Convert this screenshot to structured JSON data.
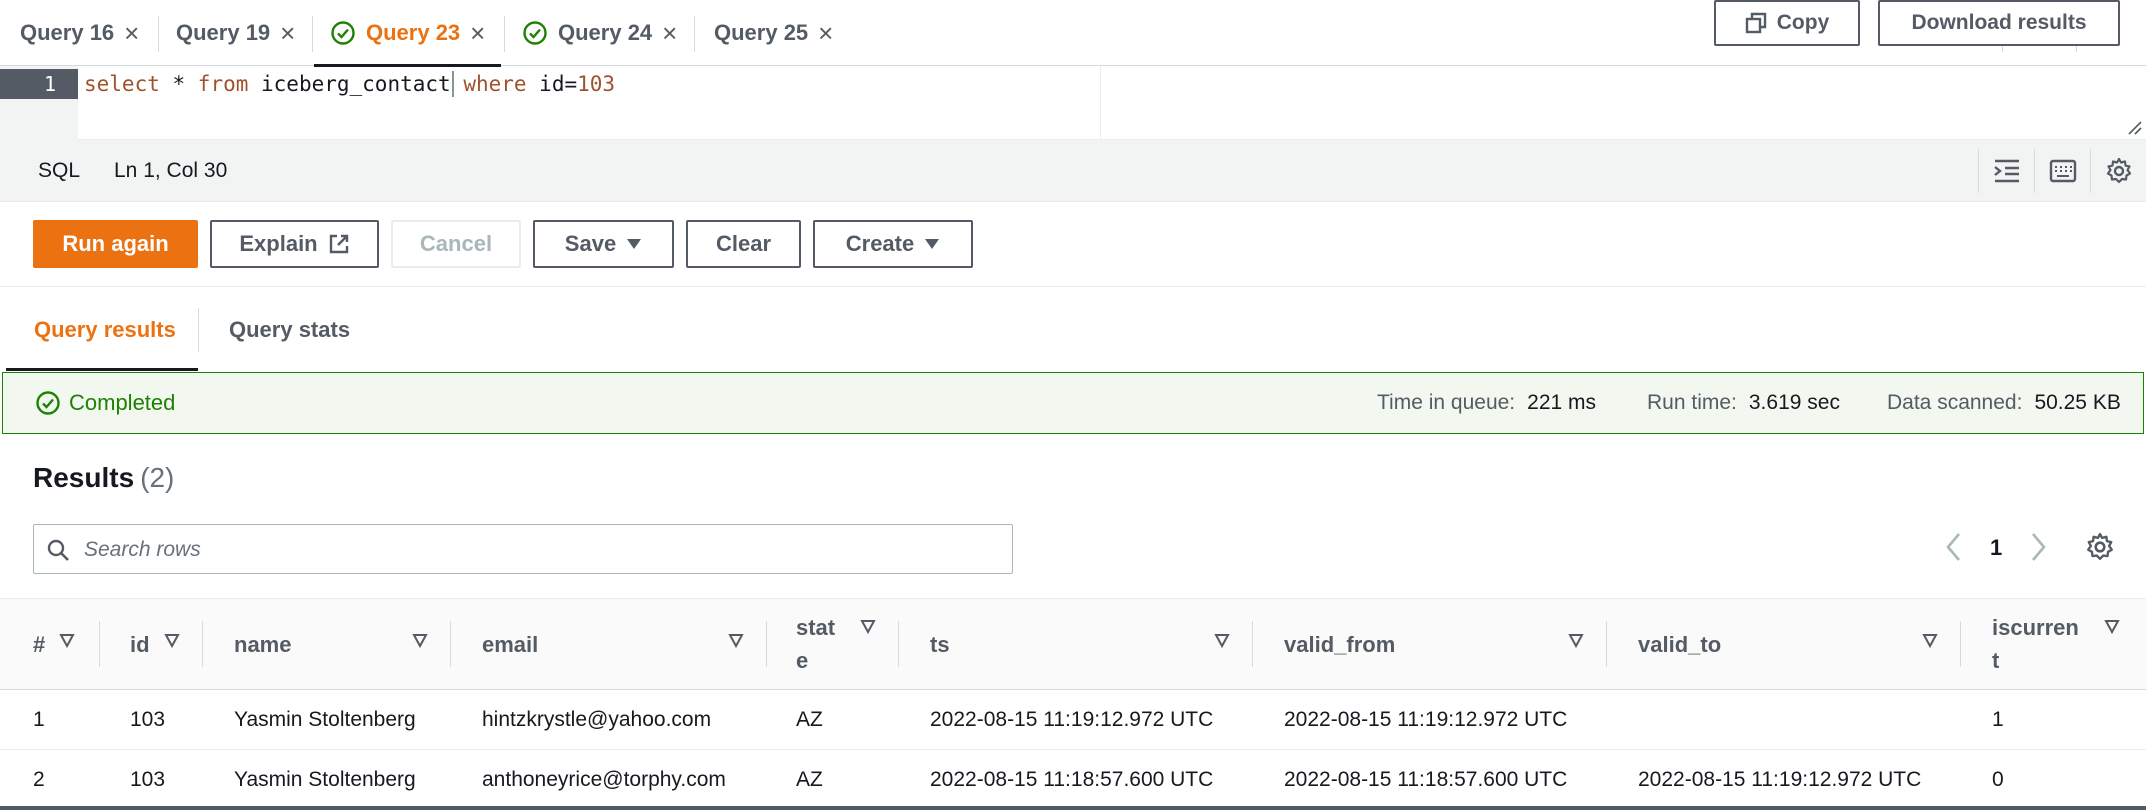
{
  "tabs": [
    {
      "label": "Query 16",
      "status": "none",
      "active": false
    },
    {
      "label": "Query 19",
      "status": "none",
      "active": false
    },
    {
      "label": "Query 23",
      "status": "success",
      "active": true
    },
    {
      "label": "Query 24",
      "status": "success",
      "active": false
    },
    {
      "label": "Query 25",
      "status": "none",
      "active": false
    }
  ],
  "editor": {
    "line_number": "1",
    "tokens": [
      "select",
      " * ",
      "from",
      " iceberg_contact ",
      "where",
      " id=",
      "103"
    ]
  },
  "status_bar": {
    "language": "SQL",
    "cursor_position": "Ln 1, Col 30"
  },
  "actions": {
    "run_again": "Run again",
    "explain": "Explain",
    "cancel": "Cancel",
    "save": "Save",
    "clear": "Clear",
    "create": "Create"
  },
  "result_tabs": [
    "Query results",
    "Query stats"
  ],
  "execution": {
    "status": "Completed",
    "time_in_queue_label": "Time in queue:",
    "time_in_queue": "221 ms",
    "run_time_label": "Run time:",
    "run_time": "3.619 sec",
    "data_scanned_label": "Data scanned:",
    "data_scanned": "50.25 KB"
  },
  "results": {
    "title": "Results",
    "count": "(2)",
    "copy_label": "Copy",
    "download_label": "Download results",
    "search_placeholder": "Search rows",
    "page": "1",
    "columns": [
      "#",
      "id",
      "name",
      "email",
      "stat\ne",
      "ts",
      "valid_from",
      "valid_to",
      "iscurren\nt"
    ],
    "rows": [
      [
        "1",
        "103",
        "Yasmin Stoltenberg",
        "hintzkrystle@yahoo.com",
        "AZ",
        "2022-08-15 11:19:12.972 UTC",
        "2022-08-15 11:19:12.972 UTC",
        "",
        "1"
      ],
      [
        "2",
        "103",
        "Yasmin Stoltenberg",
        "anthoneyrice@torphy.com",
        "AZ",
        "2022-08-15 11:18:57.600 UTC",
        "2022-08-15 11:18:57.600 UTC",
        "2022-08-15 11:19:12.972 UTC",
        "0"
      ]
    ]
  },
  "colors": {
    "accent": "#ec7211",
    "success": "#1d8102",
    "link_blue": "#0073bb",
    "text": "#16191f",
    "muted": "#545b64"
  }
}
